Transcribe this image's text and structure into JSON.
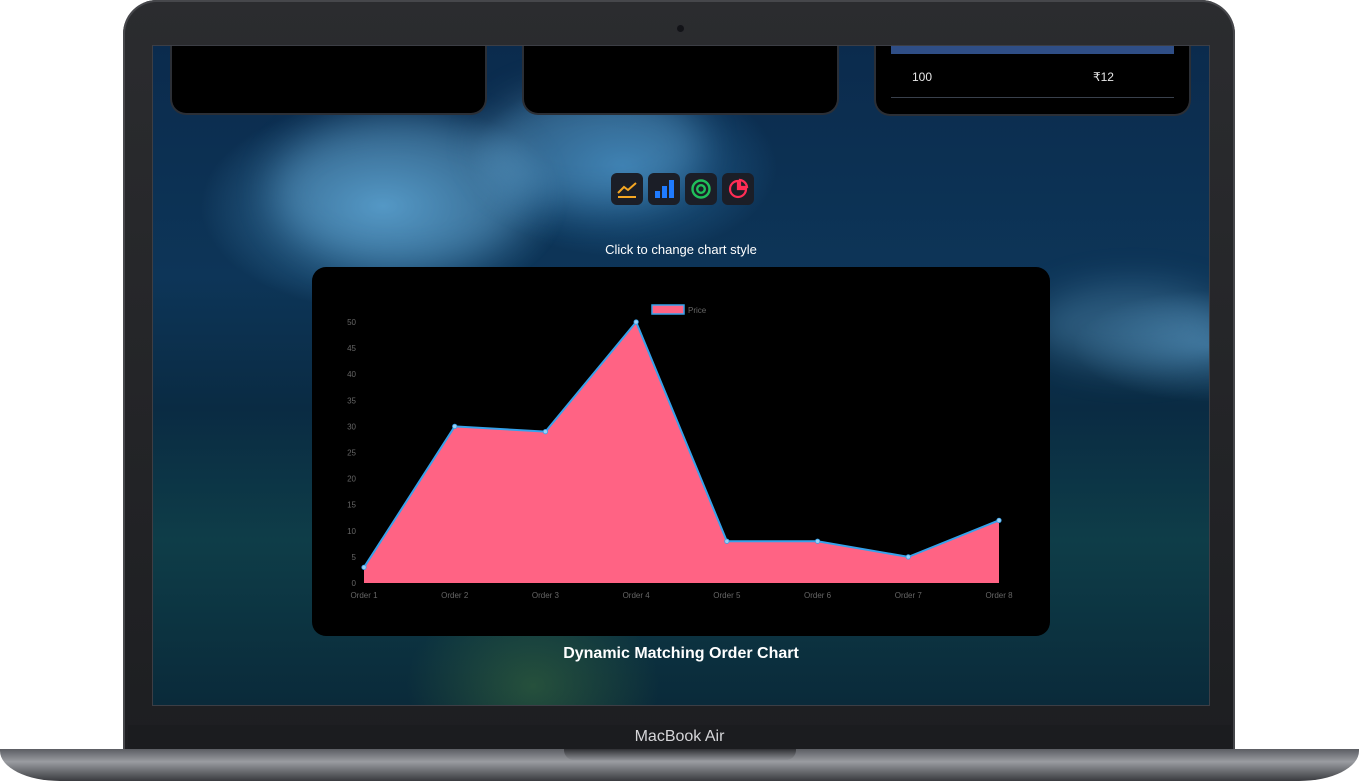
{
  "table_row": {
    "quantity": "100",
    "price": "₹12"
  },
  "toolbar": {
    "icons": [
      "line-chart-icon",
      "bar-chart-icon",
      "doughnut-chart-icon",
      "pie-chart-icon"
    ],
    "colors": {
      "line": "#f5a623",
      "bar": "#1f7bff",
      "doughnut": "#20c05a",
      "pie": "#ff2d55"
    }
  },
  "hint": "Click to change chart style",
  "chart_title": "Dynamic Matching Order Chart",
  "device_label": "MacBook Air",
  "chart_data": {
    "type": "area",
    "categories": [
      "Order 1",
      "Order 2",
      "Order 3",
      "Order 4",
      "Order 5",
      "Order 6",
      "Order 7",
      "Order 8"
    ],
    "series": [
      {
        "name": "Price",
        "values": [
          3,
          30,
          29,
          50,
          8,
          8,
          5,
          12
        ]
      }
    ],
    "ylim": [
      0,
      50
    ],
    "yticks": [
      0,
      5,
      10,
      15,
      20,
      25,
      30,
      35,
      40,
      45,
      50
    ],
    "fill_color": "#ff6384",
    "line_color": "#36a2eb",
    "legend": "top"
  }
}
